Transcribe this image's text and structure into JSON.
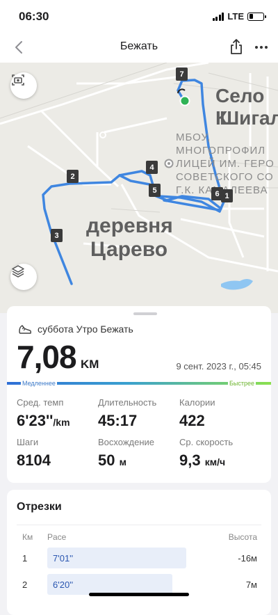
{
  "status_bar": {
    "time": "06:30",
    "network": "LTE"
  },
  "nav": {
    "title": "Бежать"
  },
  "map": {
    "labels": {
      "village_1": "Село К",
      "village_2": "Шигал",
      "village_3": "деревня",
      "village_4": "Царево"
    },
    "poi_lines": [
      "МБОУ,",
      "МНОГОПРОФИЛ",
      "ЛИЦЕЙ ИМ. ГЕРО",
      "СОВЕТСКОГО СО",
      "Г.К. КАМАЛЕЕВА"
    ],
    "route_color": "#3f86e0",
    "markers": [
      "7",
      "2",
      "4",
      "5",
      "6",
      "1",
      "3"
    ]
  },
  "summary": {
    "activity": "суббота Утро Бежать",
    "distance": "7,08",
    "distance_unit": "KM",
    "date": "9 сент. 2023 г., 05:45",
    "slower_label": "Медленнее",
    "faster_label": "Быстрее",
    "stats": {
      "avg_pace": {
        "label": "Сред. темп",
        "value": "6'23''",
        "unit": "/km"
      },
      "duration": {
        "label": "Длительность",
        "value": "45:17"
      },
      "calories": {
        "label": "Калории",
        "value": "422"
      },
      "steps": {
        "label": "Шаги",
        "value": "8104"
      },
      "ascent": {
        "label": "Восхождение",
        "value": "50",
        "unit": "м"
      },
      "avg_speed": {
        "label": "Ср. скорость",
        "value": "9,3",
        "unit": "км/ч"
      }
    }
  },
  "segments": {
    "title": "Отрезки",
    "headers": {
      "km": "Км",
      "pace": "Pace",
      "elevation": "Высота"
    },
    "rows": [
      {
        "km": "1",
        "pace": "7'01''",
        "elevation": "-16м",
        "bar_fraction": 0.91
      },
      {
        "km": "2",
        "pace": "6'20''",
        "elevation": "7м",
        "bar_fraction": 0.82
      }
    ]
  }
}
